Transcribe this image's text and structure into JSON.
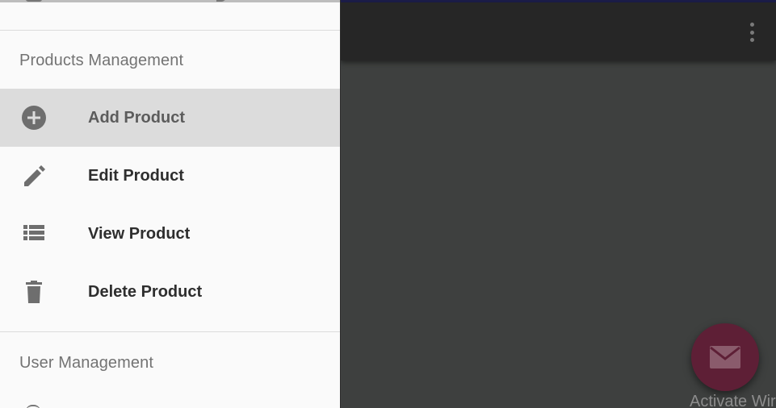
{
  "drawer": {
    "sections": [
      {
        "header": "Products Management",
        "items": [
          {
            "label": "Add Product",
            "icon": "add-circle-icon",
            "active": true
          },
          {
            "label": "Edit Product",
            "icon": "pencil-icon",
            "active": false
          },
          {
            "label": "View Product",
            "icon": "list-icon",
            "active": false
          },
          {
            "label": "Delete Product",
            "icon": "trash-icon",
            "active": false
          }
        ]
      },
      {
        "header": "User Management",
        "items": []
      }
    ]
  },
  "toolbar": {
    "menu_icon": "more-vert-icon"
  },
  "fab": {
    "icon": "mail-icon",
    "color": "#5e1f36"
  },
  "watermark": "Activate Wir",
  "colors": {
    "drawer_bg": "#fafafa",
    "active_item_bg": "#dcdcdc",
    "toolbar_bg": "#262626",
    "content_bg": "#3e403f",
    "icon_gray": "#6e6e6e"
  }
}
